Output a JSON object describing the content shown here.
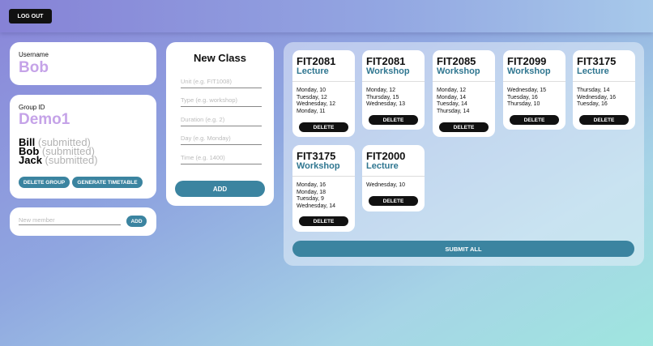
{
  "header": {
    "logout_label": "LOG OUT"
  },
  "user": {
    "label": "Username",
    "name": "Bob"
  },
  "group": {
    "label": "Group ID",
    "id": "Demo1",
    "members": [
      {
        "name": "Bill",
        "status": "(submitted)"
      },
      {
        "name": "Bob",
        "status": "(submitted)"
      },
      {
        "name": "Jack",
        "status": "(submitted)"
      }
    ],
    "delete_label": "DELETE GROUP",
    "generate_label": "GENERATE TIMETABLE"
  },
  "add_member": {
    "placeholder": "New member",
    "button_label": "ADD"
  },
  "new_class": {
    "title": "New Class",
    "unit_placeholder": "Unit (e.g. FIT1008)",
    "type_placeholder": "Type (e.g. workshop)",
    "duration_placeholder": "Duration (e.g. 2)",
    "day_placeholder": "Day (e.g. Monday)",
    "time_placeholder": "Time (e.g. 1400)",
    "add_label": "ADD"
  },
  "classes": [
    {
      "code": "FIT2081",
      "type": "Lecture",
      "days": [
        "Monday, 10",
        "Tuesday, 12",
        "Wednesday, 12",
        "Monday, 11"
      ],
      "delete_label": "DELETE"
    },
    {
      "code": "FIT2081",
      "type": "Workshop",
      "days": [
        "Monday, 12",
        "Thursday, 15",
        "Wednesday, 13"
      ],
      "delete_label": "DELETE"
    },
    {
      "code": "FIT2085",
      "type": "Workshop",
      "days": [
        "Monday, 12",
        "Monday, 14",
        "Tuesday, 14",
        "Thursday, 14"
      ],
      "delete_label": "DELETE"
    },
    {
      "code": "FIT2099",
      "type": "Workshop",
      "days": [
        "Wednesday, 15",
        "Tuesday, 16",
        "Thursday, 10"
      ],
      "delete_label": "DELETE"
    },
    {
      "code": "FIT3175",
      "type": "Lecture",
      "days": [
        "Thursday, 14",
        "Wednesday, 16",
        "Tuesday, 16"
      ],
      "delete_label": "DELETE"
    },
    {
      "code": "FIT3175",
      "type": "Workshop",
      "days": [
        "Monday, 16",
        "Monday, 18",
        "Tuesday, 9",
        "Wednesday, 14"
      ],
      "delete_label": "DELETE"
    },
    {
      "code": "FIT2000",
      "type": "Lecture",
      "days": [
        "Wednesday, 10"
      ],
      "delete_label": "DELETE"
    }
  ],
  "submit_label": "SUBMIT ALL",
  "colors": {
    "accent": "#3b84a0",
    "purple": "#c5a3e8",
    "dark": "#111111"
  }
}
